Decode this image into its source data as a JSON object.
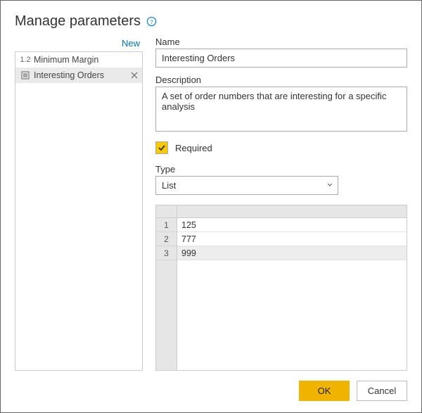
{
  "title": "Manage parameters",
  "new_link": "New",
  "sidebar": {
    "items": [
      {
        "icon": "1.2",
        "label": "Minimum Margin",
        "selected": false
      },
      {
        "icon": "list",
        "label": "Interesting Orders",
        "selected": true
      }
    ]
  },
  "form": {
    "name_label": "Name",
    "name_value": "Interesting Orders",
    "desc_label": "Description",
    "desc_value": "A set of order numbers that are interesting for a specific analysis",
    "required_checked": true,
    "required_label": "Required",
    "type_label": "Type",
    "type_value": "List"
  },
  "grid": {
    "rows": [
      {
        "n": "1",
        "v": "125"
      },
      {
        "n": "2",
        "v": "777"
      },
      {
        "n": "3",
        "v": "999"
      }
    ],
    "selected_index": 2
  },
  "footer": {
    "ok": "OK",
    "cancel": "Cancel"
  }
}
